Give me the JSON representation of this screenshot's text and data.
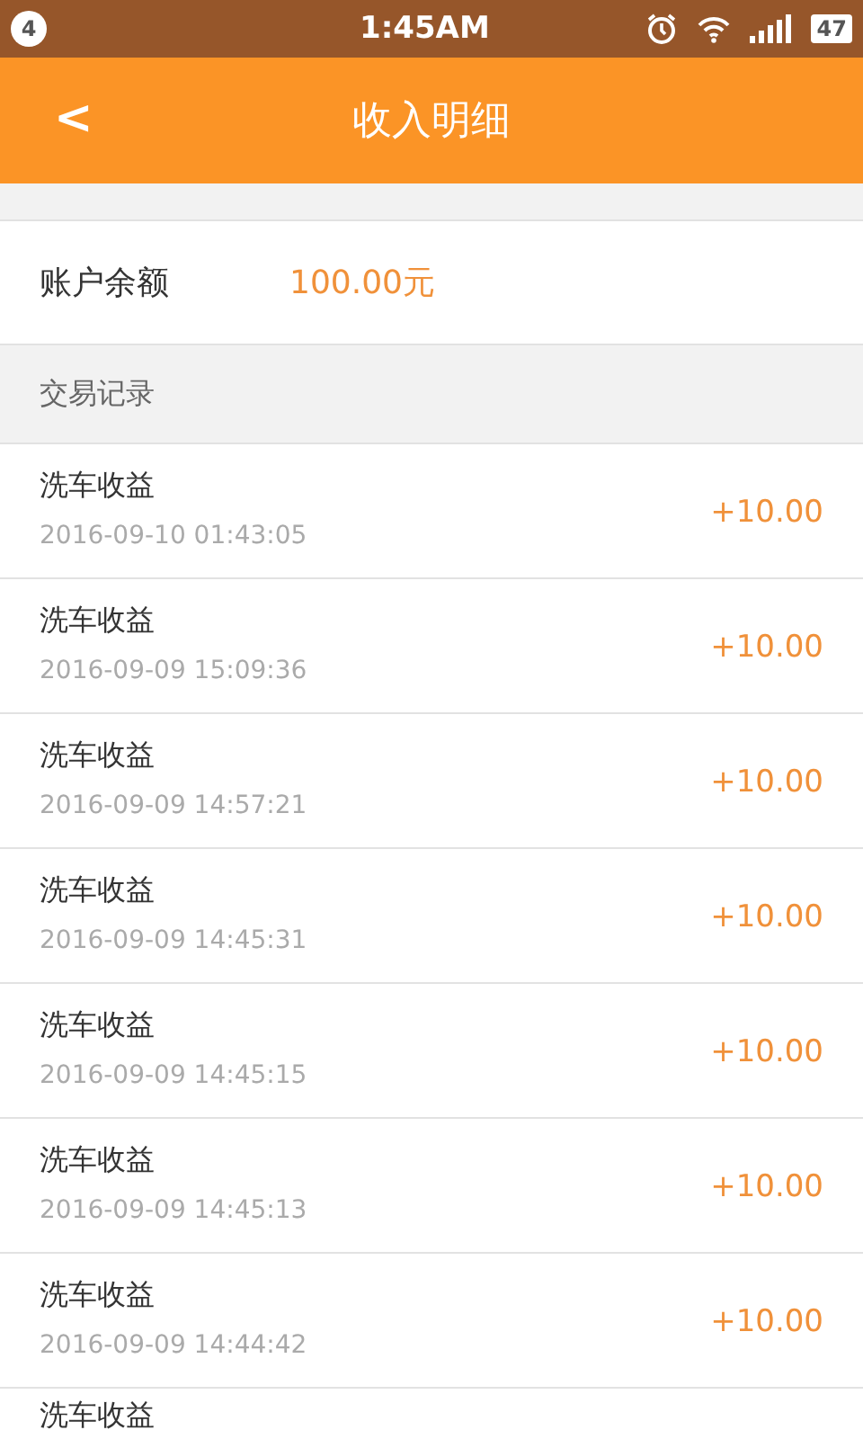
{
  "status_bar": {
    "notification_count": "4",
    "time": "1:45AM",
    "battery": "47"
  },
  "header": {
    "back": "<",
    "title": "收入明细"
  },
  "balance": {
    "label": "账户余额",
    "value": "100.00元"
  },
  "section_title": "交易记录",
  "transactions": [
    {
      "title": "洗车收益",
      "time": "2016-09-10 01:43:05",
      "amount": "+10.00"
    },
    {
      "title": "洗车收益",
      "time": "2016-09-09 15:09:36",
      "amount": "+10.00"
    },
    {
      "title": "洗车收益",
      "time": "2016-09-09 14:57:21",
      "amount": "+10.00"
    },
    {
      "title": "洗车收益",
      "time": "2016-09-09 14:45:31",
      "amount": "+10.00"
    },
    {
      "title": "洗车收益",
      "time": "2016-09-09 14:45:15",
      "amount": "+10.00"
    },
    {
      "title": "洗车收益",
      "time": "2016-09-09 14:45:13",
      "amount": "+10.00"
    },
    {
      "title": "洗车收益",
      "time": "2016-09-09 14:44:42",
      "amount": "+10.00"
    },
    {
      "title": "洗车收益"
    }
  ]
}
